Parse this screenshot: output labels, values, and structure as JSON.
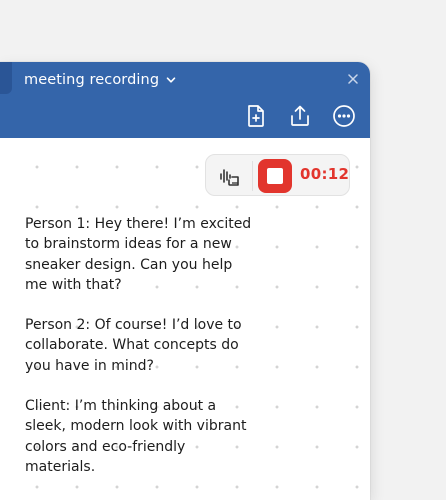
{
  "window": {
    "title": "meeting recording"
  },
  "toolbar": {
    "icons": [
      "new-document-icon",
      "share-icon",
      "more-options-icon"
    ]
  },
  "recorder": {
    "timer": "00:12",
    "accent_color": "#e2352d"
  },
  "transcript": {
    "paragraphs": [
      "Person 1: Hey there! I’m excited to brainstorm ideas for a new sneaker design. Can you help me with that?",
      "Person 2: Of course! I’d love to collaborate. What concepts do you have in mind?",
      "Client: I’m thinking about a sleek, modern look with vibrant colors and eco-friendly materials."
    ]
  },
  "colors": {
    "titlebar": "#3465aa",
    "background": "#f2f2f2"
  }
}
